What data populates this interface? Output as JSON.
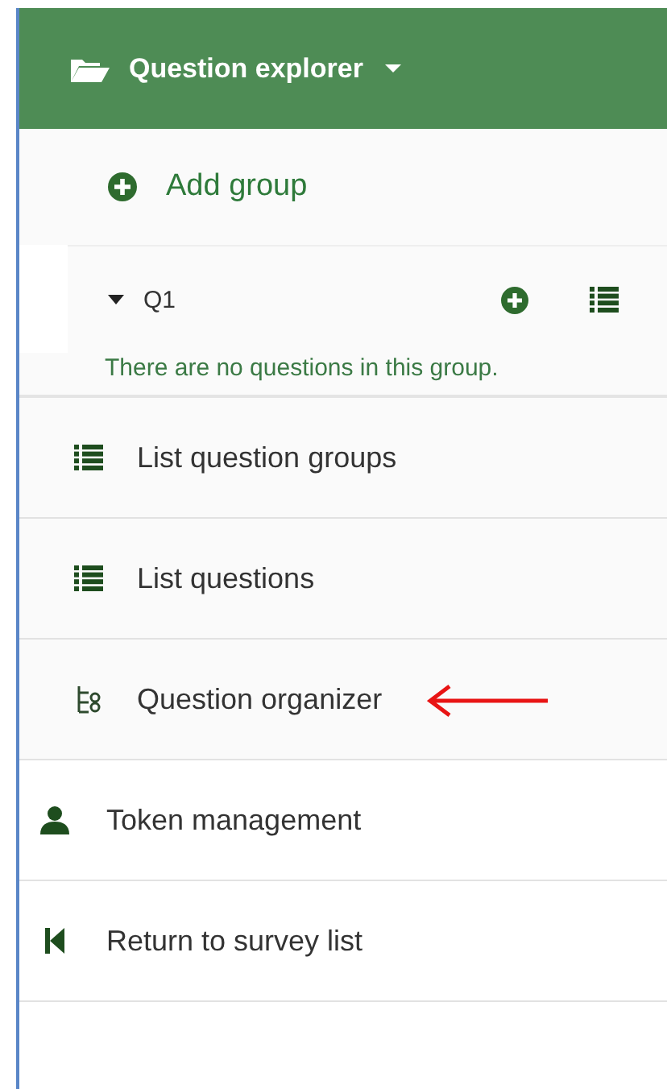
{
  "header": {
    "title": "Question explorer"
  },
  "explorer": {
    "add_label": "Add group",
    "groups": [
      {
        "title": "Q1",
        "expanded": true,
        "empty_text": "There are no questions in this group."
      }
    ]
  },
  "menu": [
    {
      "label": "List question groups",
      "kind": "nested"
    },
    {
      "label": "List questions",
      "kind": "nested"
    },
    {
      "label": "Question organizer",
      "kind": "nested",
      "annotated": true
    },
    {
      "label": "Token management",
      "kind": "top"
    },
    {
      "label": "Return to survey list",
      "kind": "top"
    }
  ]
}
